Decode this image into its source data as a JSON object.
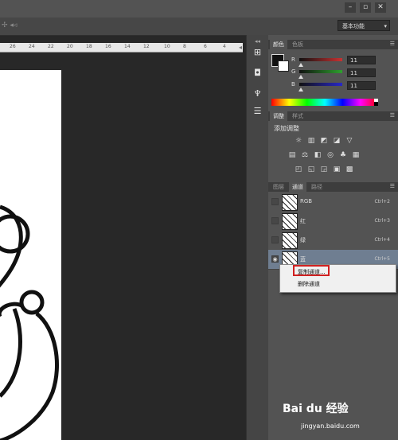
{
  "window": {
    "buttons": [
      "–",
      "▫",
      "✕"
    ],
    "workspace_label": "基本功能"
  },
  "ruler": {
    "ticks": [
      "26",
      "24",
      "22",
      "20",
      "18",
      "16",
      "14",
      "12",
      "10",
      "8",
      "6",
      "4"
    ]
  },
  "color_panel": {
    "tabs": [
      "颜色",
      "色板"
    ],
    "channels": [
      {
        "label": "R",
        "value": "11",
        "color": "#c83232"
      },
      {
        "label": "G",
        "value": "11",
        "color": "#2ea02e"
      },
      {
        "label": "B",
        "value": "11",
        "color": "#2828c8"
      }
    ]
  },
  "adjustments_panel": {
    "tabs": [
      "调整",
      "样式"
    ],
    "heading": "添加调整",
    "rows": [
      [
        "☼",
        "▥",
        "◩",
        "◪",
        "▽"
      ],
      [
        "▤",
        "⚖",
        "◧",
        "◎",
        "♣",
        "▦"
      ],
      [
        "◰",
        "◱",
        "◲",
        "▣",
        "▩"
      ]
    ]
  },
  "channels_panel": {
    "tabs": [
      "图层",
      "通道",
      "路径"
    ],
    "active_tab": "通道",
    "rows": [
      {
        "name": "RGB",
        "shortcut": "Ctrl+2",
        "visible": false,
        "selected": false
      },
      {
        "name": "红",
        "shortcut": "Ctrl+3",
        "visible": false,
        "selected": false
      },
      {
        "name": "绿",
        "shortcut": "Ctrl+4",
        "visible": false,
        "selected": false
      },
      {
        "name": "蓝",
        "shortcut": "Ctrl+5",
        "visible": true,
        "selected": true
      }
    ]
  },
  "context_menu": {
    "items": [
      "复制通道...",
      "删除通道"
    ],
    "highlighted": "复制通道..."
  },
  "watermark": {
    "brand": "Bai du 经验",
    "url": "jingyan.baidu.com"
  }
}
